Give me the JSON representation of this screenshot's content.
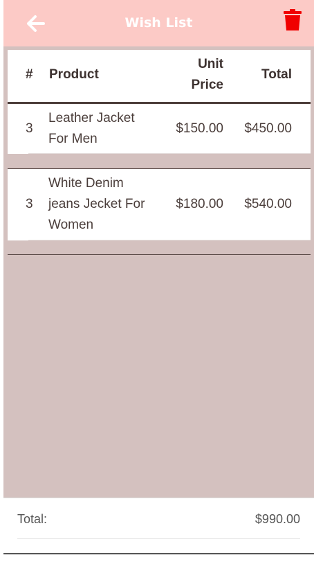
{
  "header": {
    "title": "Wish List",
    "back_icon": "arrow-left-icon",
    "delete_icon": "trash-icon",
    "bg_color": "#fccac6",
    "delete_color": "#f00000"
  },
  "table": {
    "columns": [
      "#",
      "Product",
      "Unit Price",
      "Total"
    ],
    "unit_price_header_line1": "Unit",
    "unit_price_header_line2": "Price",
    "rows": [
      {
        "qty": "3",
        "product_lines": [
          "Leather Jacket",
          "For Men"
        ],
        "unit_price": "$150.00",
        "total": "$450.00"
      },
      {
        "qty": "3",
        "product_lines": [
          "White Denim",
          "jeans Jecket For",
          "Women"
        ],
        "unit_price": "$180.00",
        "total": "$540.00"
      }
    ]
  },
  "footer": {
    "total_label": "Total:",
    "total_value": "$990.00"
  }
}
